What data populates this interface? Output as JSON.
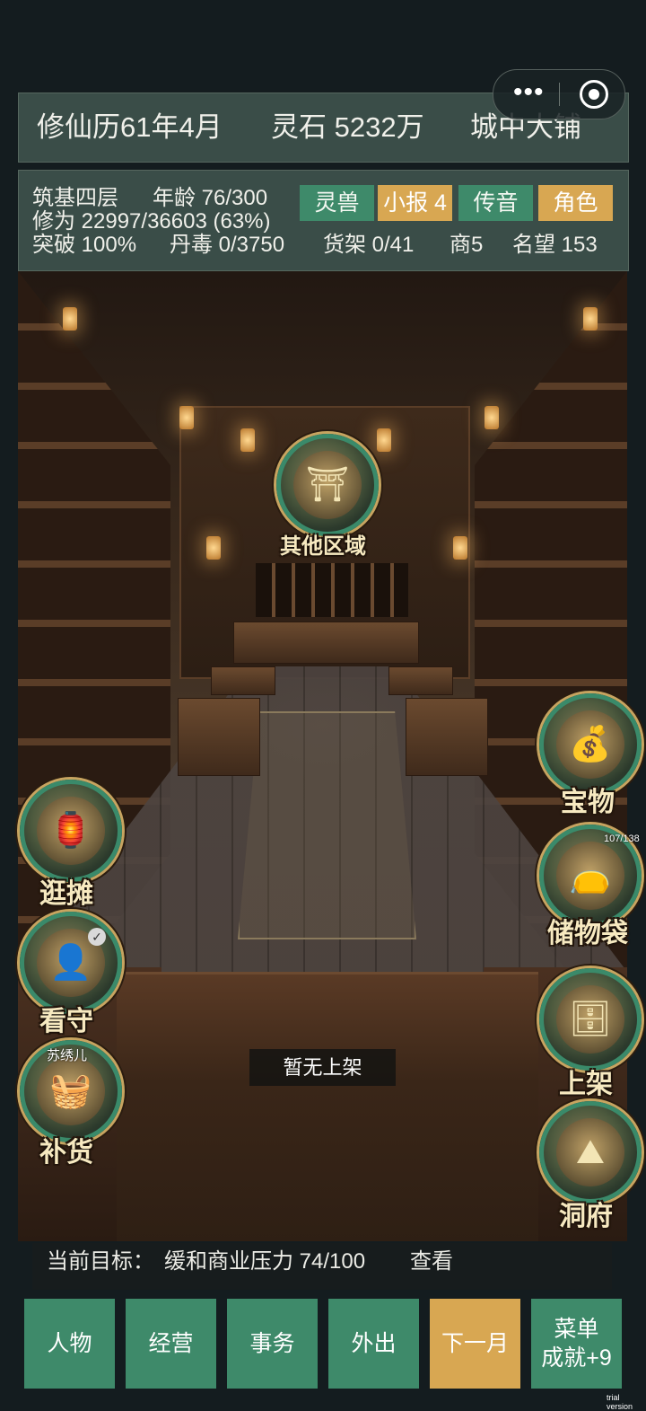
{
  "header": {
    "date": "修仙历61年4月",
    "spirit_stone": "灵石 5232万",
    "location": "城中大铺"
  },
  "capsule": {
    "more_glyph": "•••"
  },
  "stats": {
    "realm": "筑基四层",
    "age": "年龄 76/300",
    "cultivation": "修为 22997/36603 (63%)",
    "breakthrough": "突破 100%",
    "pill_poison": "丹毒 0/3750",
    "shelf": "货架 0/41",
    "merchant": "商5",
    "fame": "名望 153",
    "tags": {
      "spirit_beast": "灵兽",
      "news": "小报 4",
      "message": "传音",
      "character": "角色"
    }
  },
  "scene": {
    "other_areas": "其他区域",
    "treasure": "宝物",
    "storage_bag": "储物袋",
    "storage_count": "107/138",
    "stall": "逛摊",
    "guard": "看守",
    "restock_person": "苏绣儿",
    "restock": "补货",
    "shelve": "上架",
    "cave": "洞府",
    "empty_shelf": "暂无上架"
  },
  "goal": {
    "label": "当前目标：",
    "text": "缓和商业压力 74/100",
    "view": "查看"
  },
  "nav": {
    "character": "人物",
    "business": "经营",
    "affairs": "事务",
    "outing": "外出",
    "next_month": "下一月",
    "menu": "菜单",
    "achievements": "成就+9"
  },
  "footer": {
    "trial": "trial version"
  },
  "colors": {
    "panel": "#3a4d48",
    "green_tag": "#3e8a6a",
    "yellow_tag": "#d8a752",
    "background": "#141c1f"
  }
}
